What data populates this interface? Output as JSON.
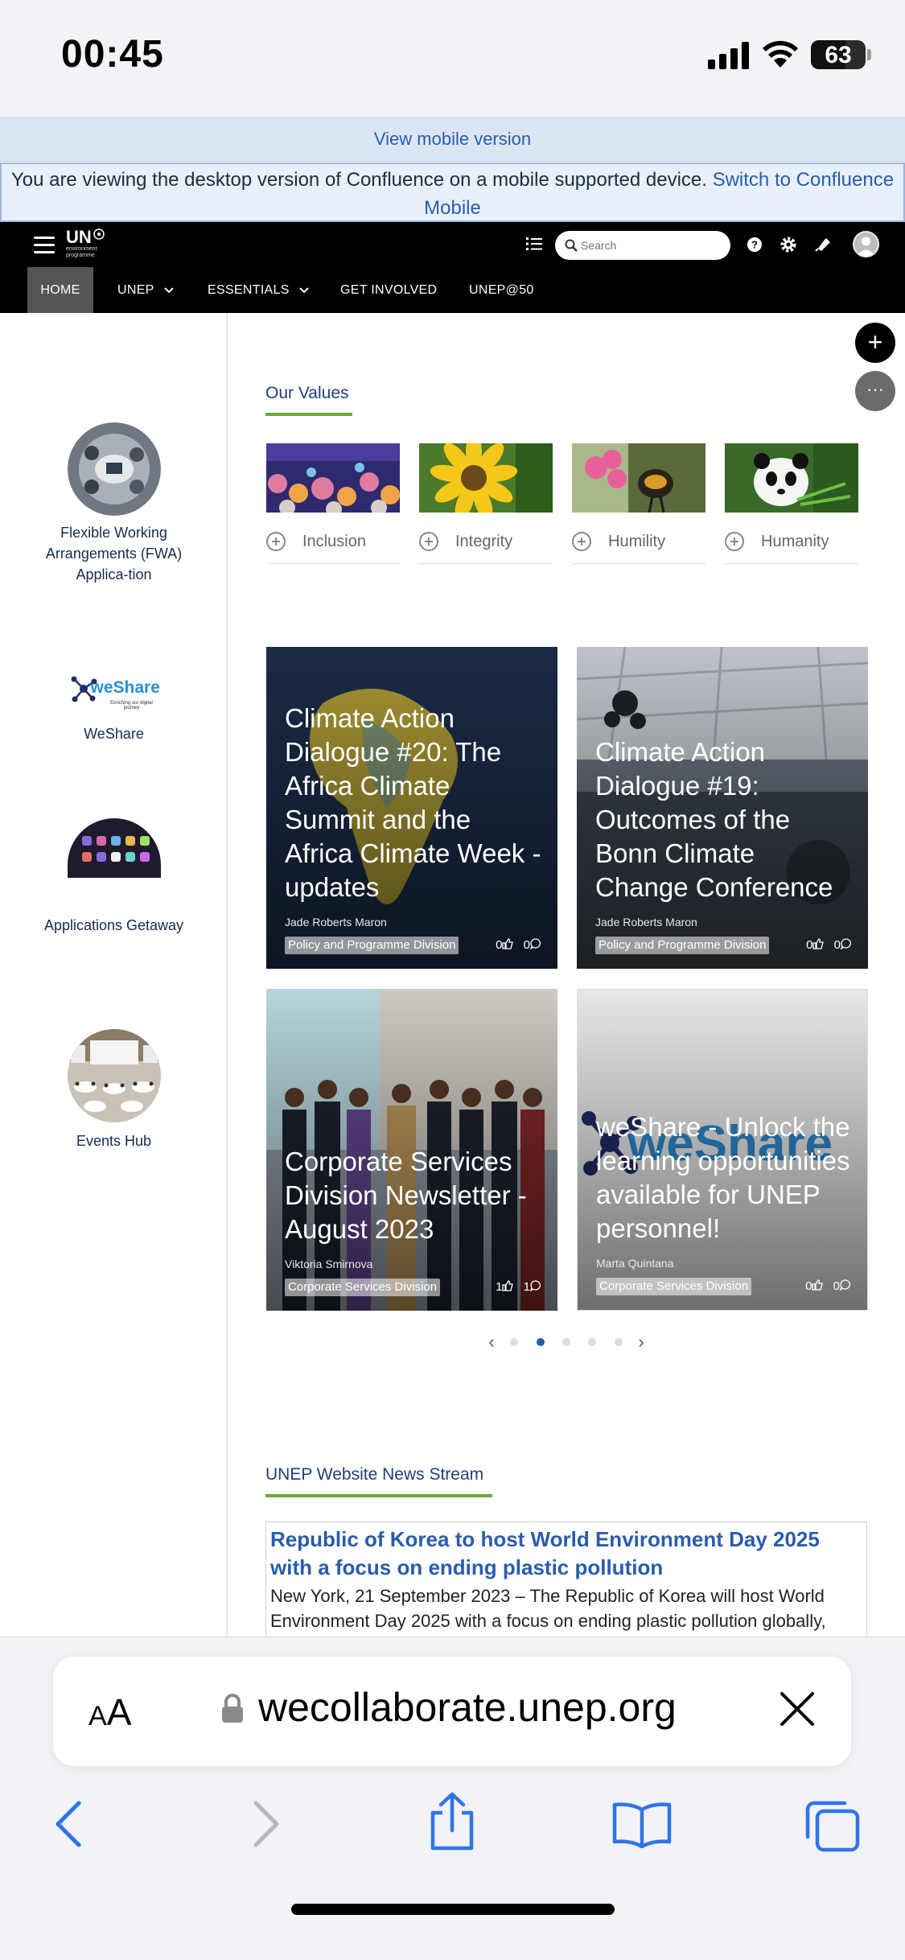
{
  "status_bar": {
    "time": "00:45",
    "battery": "63",
    "battery_level_pct": 63
  },
  "banners": {
    "mobile_version": "View mobile version",
    "desktop_notice": "You are viewing the desktop version of Confluence on a mobile supported device.",
    "switch_link": "Switch to Confluence Mobile"
  },
  "header": {
    "logo_text": "UN",
    "logo_sub": "environment programme",
    "search_placeholder": "Search",
    "nav": [
      {
        "label": "HOME"
      },
      {
        "label": "UNEP"
      },
      {
        "label": "ESSENTIALS"
      },
      {
        "label": "GET INVOLVED"
      },
      {
        "label": "UNEP@50"
      }
    ]
  },
  "sidebar": {
    "items": [
      {
        "label": "Flexible Working Arrangements (FWA) Applica-tion"
      },
      {
        "label": "WeShare",
        "logo_text": "weShare",
        "logo_tagline": "Enriching our digital journey"
      },
      {
        "label": "Applications Getaway"
      },
      {
        "label": "Events Hub"
      }
    ]
  },
  "values": {
    "title": "Our Values",
    "items": [
      {
        "label": "Inclusion"
      },
      {
        "label": "Integrity"
      },
      {
        "label": "Humility"
      },
      {
        "label": "Humanity"
      }
    ]
  },
  "cards": [
    {
      "title": "Climate Action Dialogue #20: The Africa Climate Summit and the Africa Climate Week - updates",
      "author": "Jade Roberts Maron",
      "tag": "Policy and Programme Division",
      "likes": "0",
      "comments": "0"
    },
    {
      "title": "Climate Action Dialogue #19: Outcomes of the Bonn Climate Change Conference",
      "author": "Jade Roberts Maron",
      "tag": "Policy and Programme Division",
      "likes": "0",
      "comments": "0"
    },
    {
      "title": "Corporate Services Division Newsletter - August 2023",
      "author": "Viktoria Smirnova",
      "tag": "Corporate Services Division",
      "likes": "1",
      "comments": "1"
    },
    {
      "title": "weShare - Unlock the learning opportunities available for UNEP personnel!",
      "author": "Marta Quintana",
      "tag": "Corporate Services Division",
      "likes": "0",
      "comments": "0",
      "bg_text": "weShare"
    }
  ],
  "pager": {
    "arrow_prev": "‹",
    "arrow_next": "›",
    "count": 5,
    "active": 2
  },
  "news": {
    "title": "UNEP Website News Stream",
    "headline": "Republic of Korea to host World Environment Day 2025 with a focus on ending plastic pollution",
    "body": "New York, 21 September 2023 – The Republic of Korea will host World Environment Day 2025 with a focus on ending plastic pollution globally,"
  },
  "fabs": {
    "add": "+",
    "more": "···"
  },
  "safari": {
    "aa_big": "A",
    "aa_small": "A",
    "url": "wecollaborate.unep.org"
  },
  "colors": {
    "accent": "#2a5cad",
    "underline": "#6aaa3a",
    "header": "#000000"
  }
}
